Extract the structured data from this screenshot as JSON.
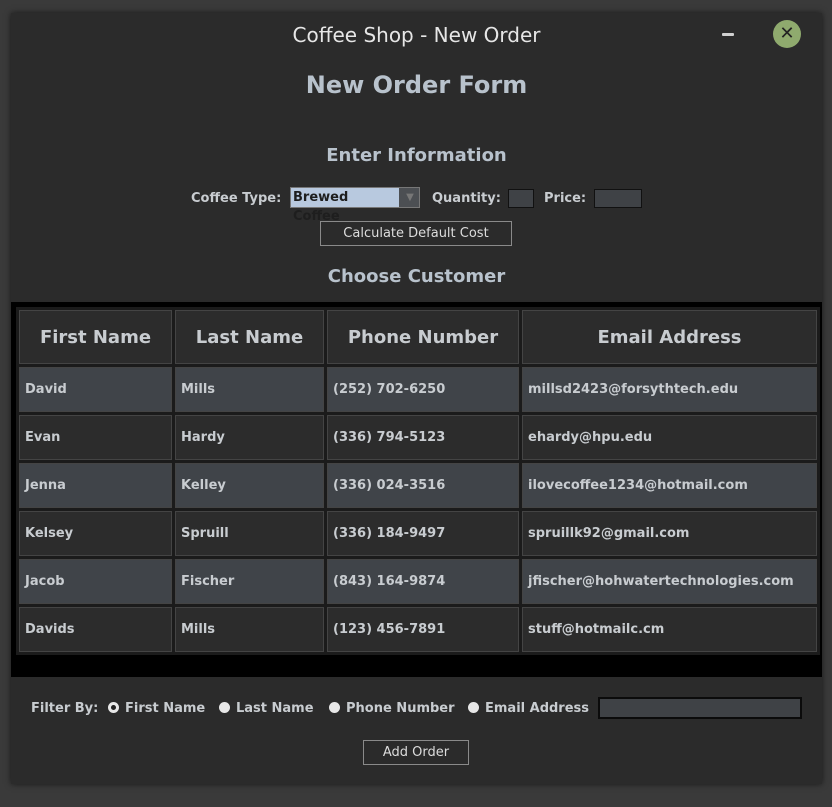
{
  "window": {
    "title": "Coffee Shop - New Order",
    "close_glyph": "✕"
  },
  "form_title": "New Order Form",
  "info_section": {
    "title": "Enter Information",
    "coffee_type_label": "Coffee Type:",
    "coffee_type_value": "Brewed Coffee",
    "quantity_label": "Quantity:",
    "quantity_value": "",
    "price_label": "Price:",
    "price_value": "",
    "calculate_button": "Calculate Default Cost"
  },
  "customer_section": {
    "title": "Choose Customer"
  },
  "table": {
    "headers": [
      "First Name",
      "Last Name",
      "Phone Number",
      "Email Address"
    ],
    "rows": [
      [
        "David",
        "Mills",
        "(252) 702-6250",
        "millsd2423@forsythtech.edu"
      ],
      [
        "Evan",
        "Hardy",
        "(336) 794-5123",
        "ehardy@hpu.edu"
      ],
      [
        "Jenna",
        "Kelley",
        "(336) 024-3516",
        "ilovecoffee1234@hotmail.com"
      ],
      [
        "Kelsey",
        "Spruill",
        "(336) 184-9497",
        "spruillk92@gmail.com"
      ],
      [
        "Jacob",
        "Fischer",
        "(843) 164-9874",
        "jfischer@hohwatertechnologies.com"
      ],
      [
        "Davids",
        "Mills",
        "(123) 456-7891",
        "stuff@hotmailc.cm"
      ]
    ]
  },
  "filter": {
    "label": "Filter By:",
    "options": [
      "First Name",
      "Last Name",
      "Phone Number",
      "Email Address"
    ],
    "selected": "First Name",
    "search_value": ""
  },
  "add_order_button": "Add Order",
  "colors": {
    "window_bg": "#2b2b2b",
    "heading": "#b8c2cc",
    "close_button": "#8faa6e",
    "selection": "#b8c9df",
    "row_alt": "#404449"
  }
}
